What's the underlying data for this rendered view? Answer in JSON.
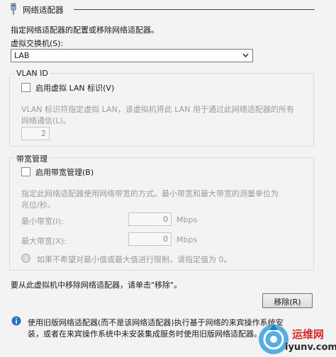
{
  "header": {
    "title": "网络适配器"
  },
  "intro": "指定网络适配器的配置或移除网络适配器。",
  "switch": {
    "label": "虚拟交换机(S):",
    "value": "LAB"
  },
  "vlan": {
    "group_label": "VLAN ID",
    "checkbox_label": "启用虚拟 LAN 标识(V)",
    "desc_line1": "VLAN 标识符指定虚拟 LAN，该虚拟机将此 LAN 用于通过此网络适配器的所有",
    "desc_line2": "网络通信(L)。",
    "id_value": "2"
  },
  "bandwidth": {
    "group_label": "带宽管理",
    "checkbox_label": "启用带宽管理(B)",
    "desc_line1": "指定此网络适配器使用网络带宽的方式。最小带宽和最大带宽的测量单位为",
    "desc_line2": "兆位/秒。",
    "min_label": "最小带宽(I):",
    "min_value": "0",
    "max_label": "最大带宽(X):",
    "max_value": "0",
    "unit": "Mbps",
    "info_text": "如果不希望对最小值或最大值进行限制，请指定值为 0。"
  },
  "remove": {
    "prompt": "要从此虚拟机中移除网络适配器，请单击\"移除\"。",
    "button_label": "移除(R)"
  },
  "legacy": {
    "line1": "使用旧版网络适配器(而不是该网络适配器)执行基于网络的来宾操作系统安",
    "line2": "装，或者在来宾操作系统中未安装集成服务时使用旧版网络适配器。"
  },
  "watermark": {
    "brand": "运维网",
    "url": "iyunv.com"
  }
}
